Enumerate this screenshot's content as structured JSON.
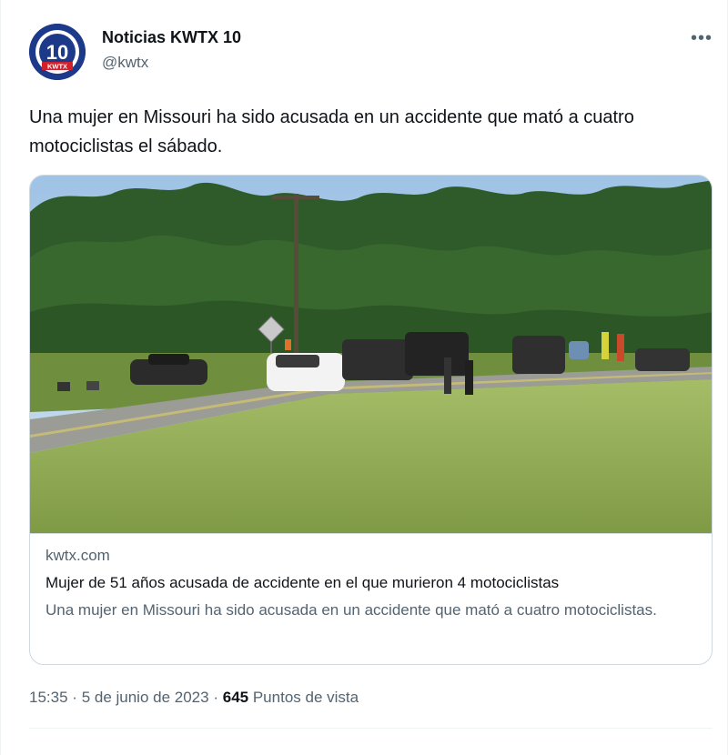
{
  "author": {
    "name": "Noticias KWTX 10",
    "handle": "@kwtx",
    "avatar_text": "KWTX",
    "avatar_number": "10"
  },
  "more_icon": "more-horizontal-icon",
  "tweet": {
    "text": "Una mujer en Missouri ha sido acusada en un accidente que mató a cuatro motociclistas el sábado."
  },
  "card": {
    "domain": "kwtx.com",
    "title": "Mujer de 51 años acusada de accidente en el que murieron 4 motociclistas",
    "description": "Una mujer en Missouri ha sido acusada en un accidente que mató a cuatro motociclistas."
  },
  "meta": {
    "time": "15:35",
    "separator": "·",
    "date": "5 de junio de 2023",
    "views_count": "645",
    "views_label": "Puntos de vista"
  },
  "colors": {
    "text_primary": "#0f1419",
    "text_secondary": "#536471",
    "border": "#cfd9de",
    "avatar_bg": "#1d3a8a",
    "avatar_red": "#d0202b"
  }
}
